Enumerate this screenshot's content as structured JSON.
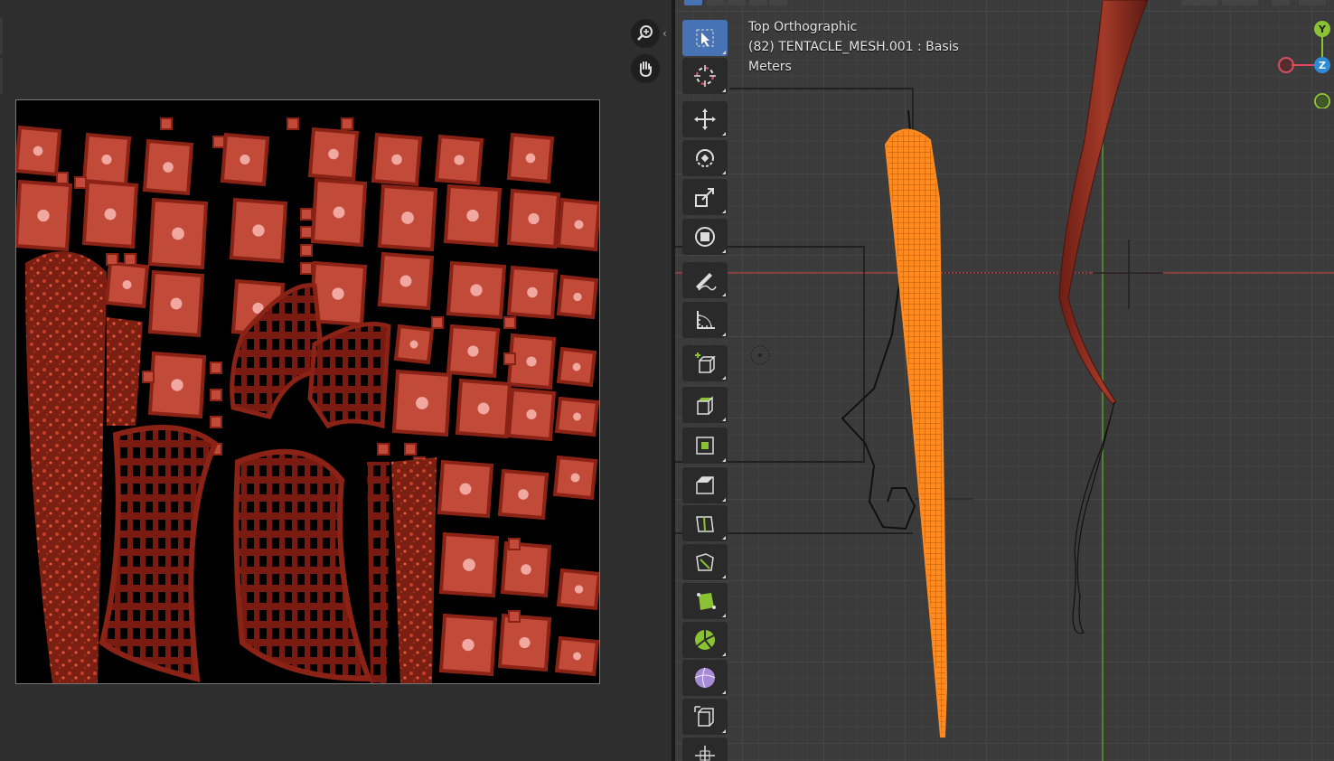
{
  "image_editor": {
    "nav_buttons": [
      {
        "name": "zoom",
        "icon": "magnifier-zoom-icon"
      },
      {
        "name": "pan",
        "icon": "hand-pan-icon"
      }
    ],
    "texture": {
      "description_icon": "uv-texture-image"
    }
  },
  "viewport": {
    "info": {
      "view_name": "Top Orthographic",
      "object_line": "(82) TENTACLE_MESH.001 : Basis",
      "units": "Meters"
    },
    "tools": [
      {
        "id": "select-box",
        "icon": "select-box-icon",
        "active": true
      },
      {
        "id": "cursor",
        "icon": "cursor-icon",
        "active": false
      },
      {
        "id": "move",
        "icon": "move-icon",
        "active": false
      },
      {
        "id": "rotate",
        "icon": "rotate-icon",
        "active": false
      },
      {
        "id": "scale",
        "icon": "scale-icon",
        "active": false
      },
      {
        "id": "transform",
        "icon": "transform-icon",
        "active": false
      },
      {
        "id": "annotate",
        "icon": "annotate-pencil-icon",
        "active": false
      },
      {
        "id": "measure",
        "icon": "measure-ruler-icon",
        "active": false
      },
      {
        "id": "add-cube",
        "icon": "add-cube-icon",
        "active": false
      },
      {
        "id": "extrude",
        "icon": "extrude-icon",
        "active": false
      },
      {
        "id": "inset",
        "icon": "inset-faces-icon",
        "active": false
      },
      {
        "id": "bevel",
        "icon": "bevel-icon",
        "active": false
      },
      {
        "id": "loop-cut",
        "icon": "loop-cut-icon",
        "active": false
      },
      {
        "id": "knife",
        "icon": "knife-icon",
        "active": false
      },
      {
        "id": "poly-build",
        "icon": "poly-build-icon",
        "active": false
      },
      {
        "id": "spin",
        "icon": "spin-icon",
        "active": false
      },
      {
        "id": "smooth",
        "icon": "smooth-vertices-icon",
        "active": false
      },
      {
        "id": "edge-slide",
        "icon": "edge-slide-icon",
        "active": false
      },
      {
        "id": "shrink-fatten",
        "icon": "shrink-fatten-icon",
        "active": false
      }
    ],
    "gizmo": {
      "y_label": "Y",
      "z_label": "Z",
      "colors": {
        "x": "#e04b5b",
        "y": "#8ac233",
        "z": "#2f8bd6"
      }
    },
    "colors": {
      "mesh": "#ff8a1f",
      "grid": "#454545",
      "x_axis": "#b24040",
      "y_axis": "#5c9a2e"
    }
  }
}
